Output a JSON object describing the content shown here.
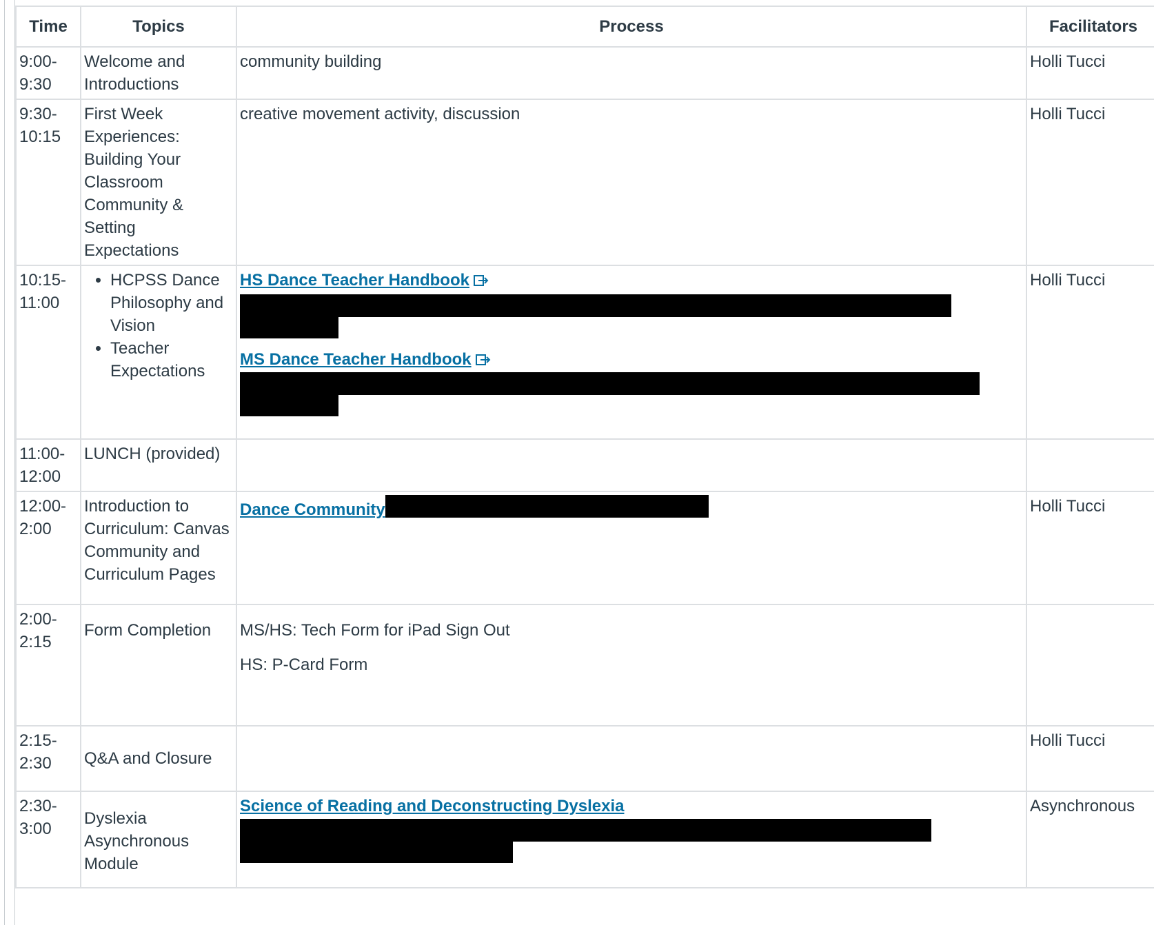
{
  "headers": {
    "time": "Time",
    "topics": "Topics",
    "process": "Process",
    "facilitators": "Facilitators"
  },
  "rows": [
    {
      "time": "9:00-9:30",
      "topic": "Welcome and Introductions",
      "process": "community building",
      "facilitator": "Holli Tucci"
    },
    {
      "time": "9:30-10:15",
      "topic": "First Week Experiences: Building Your Classroom Community & Setting Expectations",
      "process": "creative movement activity, discussion",
      "facilitator": "Holli Tucci"
    },
    {
      "time": "10:15-11:00",
      "topics": [
        "HCPSS Dance Philosophy and Vision",
        "Teacher Expectations"
      ],
      "links": [
        "HS Dance Teacher Handbook",
        "MS Dance Teacher Handbook"
      ],
      "facilitator": "Holli Tucci"
    },
    {
      "time": "11:00-12:00",
      "topic": "LUNCH (provided)",
      "process": "",
      "facilitator": ""
    },
    {
      "time": "12:00-2:00",
      "topic": "Introduction to Curriculum: Canvas Community and Curriculum Pages",
      "link": "Dance Community",
      "facilitator": "Holli Tucci"
    },
    {
      "time": "2:00-2:15",
      "topic": "Form Completion",
      "process_lines": [
        "MS/HS: Tech Form for iPad Sign Out",
        "HS: P-Card Form"
      ],
      "facilitator": ""
    },
    {
      "time": "2:15-2:30",
      "topic": "Q&A and Closure",
      "process": "",
      "facilitator": "Holli Tucci"
    },
    {
      "time": "2:30-3:00",
      "topic": "Dyslexia Asynchronous Module",
      "link": "Science of Reading and Deconstructing Dyslexia",
      "facilitator": "Asynchronous"
    }
  ],
  "icons": {
    "external_link": "external-link-icon"
  },
  "colors": {
    "link": "#0770a3",
    "text": "#2d3b45",
    "border": "#dcdfe2",
    "redaction": "#000000"
  }
}
